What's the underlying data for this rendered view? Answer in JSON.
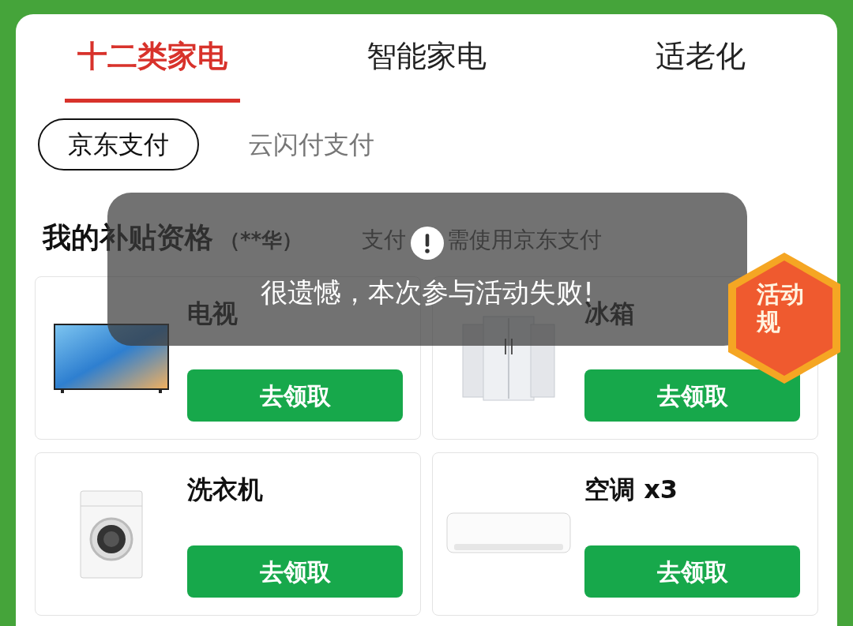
{
  "tabs": [
    {
      "label": "十二类家电",
      "selected": true
    },
    {
      "label": "智能家电",
      "selected": false
    },
    {
      "label": "适老化",
      "selected": false
    }
  ],
  "payment_options": [
    {
      "label": "京东支付",
      "selected": true
    },
    {
      "label": "云闪付支付",
      "selected": false
    }
  ],
  "eligibility": {
    "title": "我的补贴资格",
    "holder": "（**华）",
    "note_start": "支付",
    "note_end": "需使用京东支付"
  },
  "products": [
    {
      "name": "电视",
      "kind": "tv",
      "button": "去领取"
    },
    {
      "name": "冰箱",
      "kind": "fridge",
      "button": "去领取"
    },
    {
      "name": "洗衣机",
      "kind": "washer",
      "button": "去领取"
    },
    {
      "name": "空调 x3",
      "kind": "ac",
      "button": "去领取"
    }
  ],
  "toast": {
    "message": "很遗憾，本次参与活动失败!"
  },
  "badge": {
    "text": "活动规"
  }
}
